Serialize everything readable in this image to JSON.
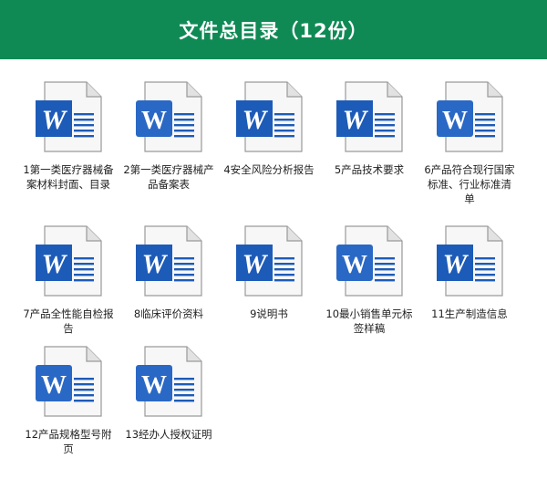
{
  "header": {
    "title": "文件总目录（12份）"
  },
  "colors": {
    "header_bg": "#108a55",
    "word_blue": "#1d5bb8",
    "word_blue_alt": "#2a68c5"
  },
  "files": [
    {
      "name": "1第一类医疗器械备案材料封面、目录",
      "icon": "word-doc-icon",
      "style": "classic"
    },
    {
      "name": "2第一类医疗器械产品备案表",
      "icon": "word-doc-icon",
      "style": "modern"
    },
    {
      "name": "4安全风险分析报告",
      "icon": "word-doc-icon",
      "style": "classic"
    },
    {
      "name": "5产品技术要求",
      "icon": "word-doc-icon",
      "style": "classic"
    },
    {
      "name": "6产品符合现行国家标准、行业标准清单",
      "icon": "word-doc-icon",
      "style": "modern"
    },
    {
      "name": "7产品全性能自检报告",
      "icon": "word-doc-icon",
      "style": "classic"
    },
    {
      "name": "8临床评价资料",
      "icon": "word-doc-icon",
      "style": "classic"
    },
    {
      "name": "9说明书",
      "icon": "word-doc-icon",
      "style": "classic"
    },
    {
      "name": "10最小销售单元标签样稿",
      "icon": "word-doc-icon",
      "style": "modern"
    },
    {
      "name": "11生产制造信息",
      "icon": "word-doc-icon",
      "style": "classic"
    },
    {
      "name": "12产品规格型号附页",
      "icon": "word-doc-icon",
      "style": "modern"
    },
    {
      "name": "13经办人授权证明",
      "icon": "word-doc-icon",
      "style": "modern"
    }
  ]
}
